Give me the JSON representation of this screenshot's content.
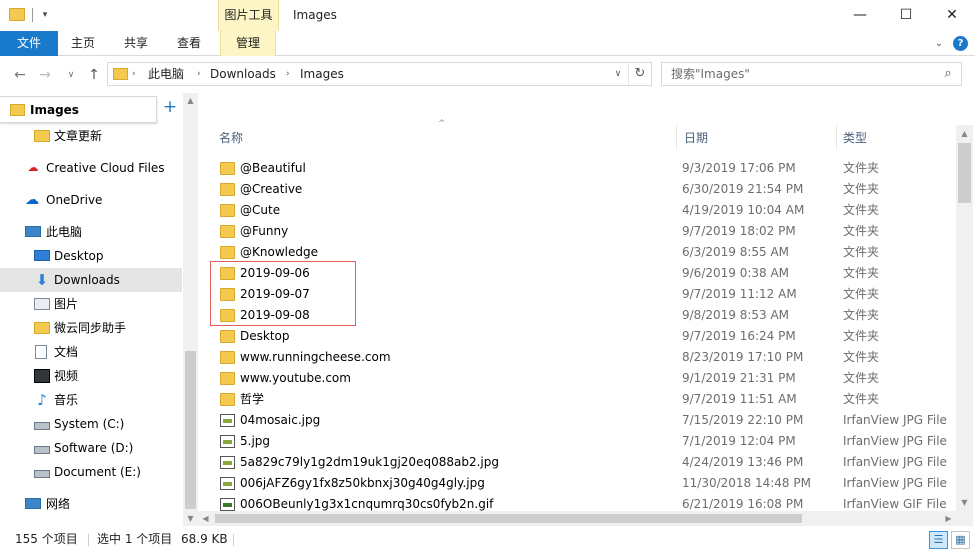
{
  "titlebar": {
    "context_tab": "图片工具",
    "title": "Images",
    "minimize": "—",
    "maximize": "☐",
    "close": "✕",
    "qa_dropdown": "▾"
  },
  "ribbon": {
    "file": "文件",
    "home": "主页",
    "share": "共享",
    "view": "查看",
    "manage": "管理",
    "expand": "⌄",
    "help": "?"
  },
  "nav": {
    "back": "←",
    "forward": "→",
    "recent": "∨",
    "up": "↑",
    "breadcrumb": [
      "此电脑",
      "Downloads",
      "Images"
    ],
    "chevron": "›",
    "dropdown": "∨",
    "refresh": "↻"
  },
  "search": {
    "placeholder": "搜索\"Images\"",
    "icon": "⌕"
  },
  "navpane": {
    "header": "Images",
    "pin": "+",
    "items": [
      {
        "label": "文章更新",
        "icon": "folder-icon"
      },
      {
        "label": "Creative Cloud Files",
        "icon": "creative-cloud-icon",
        "glyph": "☁"
      },
      {
        "label": "OneDrive",
        "icon": "onedrive-icon",
        "glyph": "☁"
      },
      {
        "label": "此电脑",
        "icon": "pc-icon"
      },
      {
        "label": "Desktop",
        "icon": "desktop-icon"
      },
      {
        "label": "Downloads",
        "icon": "download-icon",
        "glyph": "⬇"
      },
      {
        "label": "图片",
        "icon": "pictures-icon"
      },
      {
        "label": "微云同步助手",
        "icon": "weiyun-icon"
      },
      {
        "label": "文档",
        "icon": "documents-icon"
      },
      {
        "label": "视频",
        "icon": "video-icon"
      },
      {
        "label": "音乐",
        "icon": "music-icon",
        "glyph": "♪"
      },
      {
        "label": "System (C:)",
        "icon": "drive-icon"
      },
      {
        "label": "Software (D:)",
        "icon": "drive-icon"
      },
      {
        "label": "Document (E:)",
        "icon": "drive-icon"
      },
      {
        "label": "网络",
        "icon": "network-icon"
      }
    ],
    "selected": "Downloads"
  },
  "filelist": {
    "sort_caret": "^",
    "columns": {
      "name": "名称",
      "date": "日期",
      "type": "类型"
    },
    "rows": [
      {
        "name": "@Beautiful",
        "date": "9/3/2019 17:06 PM",
        "type": "文件夹",
        "kind": "folder"
      },
      {
        "name": "@Creative",
        "date": "6/30/2019 21:54 PM",
        "type": "文件夹",
        "kind": "folder"
      },
      {
        "name": "@Cute",
        "date": "4/19/2019 10:04 AM",
        "type": "文件夹",
        "kind": "folder"
      },
      {
        "name": "@Funny",
        "date": "9/7/2019 18:02 PM",
        "type": "文件夹",
        "kind": "folder"
      },
      {
        "name": "@Knowledge",
        "date": "6/3/2019 8:55 AM",
        "type": "文件夹",
        "kind": "folder"
      },
      {
        "name": "2019-09-06",
        "date": "9/6/2019 0:38 AM",
        "type": "文件夹",
        "kind": "folder"
      },
      {
        "name": "2019-09-07",
        "date": "9/7/2019 11:12 AM",
        "type": "文件夹",
        "kind": "folder"
      },
      {
        "name": "2019-09-08",
        "date": "9/8/2019 8:53 AM",
        "type": "文件夹",
        "kind": "folder"
      },
      {
        "name": "Desktop",
        "date": "9/7/2019 16:24 PM",
        "type": "文件夹",
        "kind": "folder"
      },
      {
        "name": "www.runningcheese.com",
        "date": "8/23/2019 17:10 PM",
        "type": "文件夹",
        "kind": "folder"
      },
      {
        "name": "www.youtube.com",
        "date": "9/1/2019 21:31 PM",
        "type": "文件夹",
        "kind": "folder"
      },
      {
        "name": "哲学",
        "date": "9/7/2019 11:51 AM",
        "type": "文件夹",
        "kind": "folder"
      },
      {
        "name": "04mosaic.jpg",
        "date": "7/15/2019 22:10 PM",
        "type": "IrfanView JPG File",
        "kind": "jpg"
      },
      {
        "name": "5.jpg",
        "date": "7/1/2019 12:04 PM",
        "type": "IrfanView JPG File",
        "kind": "jpg"
      },
      {
        "name": "5a829c79ly1g2dm19uk1gj20eq088ab2.jpg",
        "date": "4/24/2019 13:46 PM",
        "type": "IrfanView JPG File",
        "kind": "jpg"
      },
      {
        "name": "006jAFZ6gy1fx8z50kbnxj30g40g4gly.jpg",
        "date": "11/30/2018 14:48 PM",
        "type": "IrfanView JPG File",
        "kind": "jpg"
      },
      {
        "name": "006OBeunly1g3x1cnqumrq30cs0fyb2n.gif",
        "date": "6/21/2019 16:08 PM",
        "type": "IrfanView GIF File",
        "kind": "gif"
      }
    ]
  },
  "status": {
    "count": "155 个项目",
    "selected": "选中 1 个项目",
    "size": "68.9 KB",
    "details_view": "☰",
    "tiles_view": "▦"
  }
}
